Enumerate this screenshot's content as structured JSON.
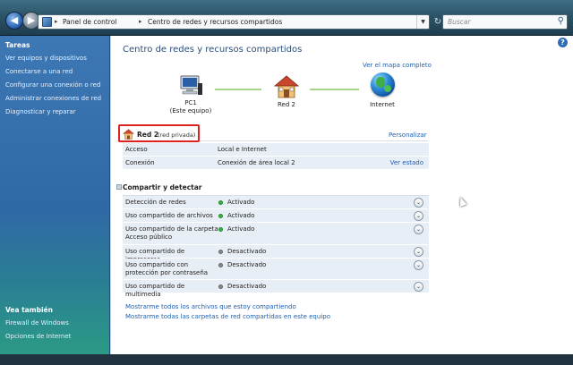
{
  "address": {
    "crumbs": [
      "Panel de control",
      "Centro de redes y recursos compartidos"
    ],
    "search_placeholder": "Buscar"
  },
  "sidebar": {
    "tasks_heading": "Tareas",
    "tasks": [
      "Ver equipos y dispositivos",
      "Conectarse a una red",
      "Configurar una conexión o red",
      "Administrar conexiones de red",
      "Diagnosticar y reparar"
    ],
    "see_also_heading": "Vea también",
    "see_also": [
      "Firewall de Windows",
      "Opciones de Internet"
    ]
  },
  "main": {
    "title": "Centro de redes y recursos compartidos",
    "full_map_link": "Ver el mapa completo",
    "map": {
      "pc_name": "PC1",
      "pc_sub": "(Este equipo)",
      "network": "Red 2",
      "internet": "Internet"
    },
    "network": {
      "name": "Red 2",
      "type": "(red privada)",
      "customize_link": "Personalizar",
      "properties": [
        {
          "key": "Acceso",
          "value": "Local e Internet",
          "action": ""
        },
        {
          "key": "Conexión",
          "value": "Conexión de área local 2",
          "action": "Ver estado"
        }
      ]
    },
    "sharing": {
      "heading": "Compartir y detectar",
      "rows": [
        {
          "key": "Detección de redes",
          "status": "Activado",
          "on": true
        },
        {
          "key": "Uso compartido de archivos",
          "status": "Activado",
          "on": true
        },
        {
          "key": "Uso compartido de la carpeta Acceso público",
          "status": "Activado",
          "on": true
        },
        {
          "key": "Uso compartido de impresoras",
          "status": "Desactivado",
          "on": false
        },
        {
          "key": "Uso compartido con protección por contraseña",
          "status": "Desactivado",
          "on": false
        },
        {
          "key": "Uso compartido de multimedia",
          "status": "Desactivado",
          "on": false
        }
      ]
    },
    "bottom_links": [
      "Mostrarme todos los archivos que estoy compartiendo",
      "Mostrarme todas las carpetas de red compartidas en este equipo"
    ]
  }
}
